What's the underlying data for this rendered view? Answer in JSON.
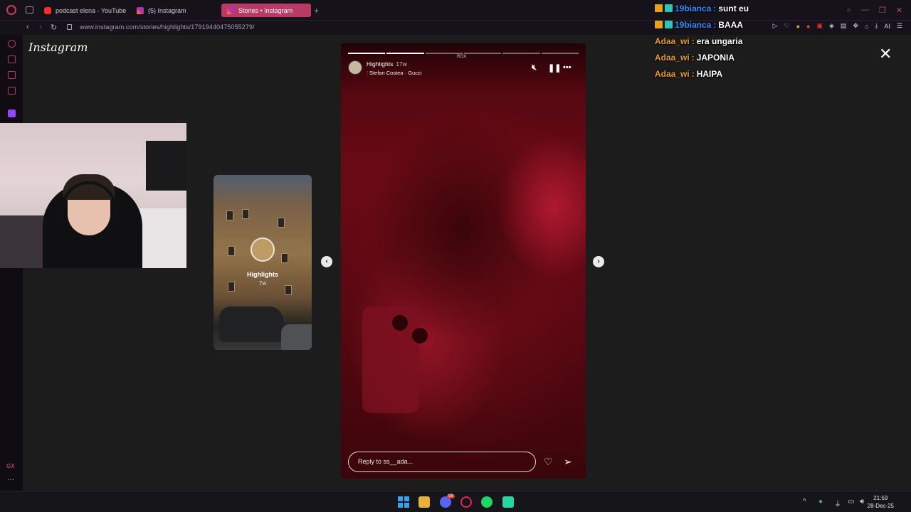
{
  "browser": {
    "tabs": [
      {
        "label": "podcast elena - YouTube",
        "icon": "youtube-icon"
      },
      {
        "label": "(5) Instagram",
        "icon": "instagram-icon"
      },
      {
        "label": "Stories • Instagram",
        "icon": "instagram-icon",
        "active": true
      }
    ],
    "url": "www.instagram.com/stories/highlights/17919440475055279/"
  },
  "instagram": {
    "logo": "Instagram",
    "side_story": {
      "title": "Highlights",
      "time": "7w"
    },
    "story": {
      "watermark": "RGX",
      "username": "Highlights",
      "time": "17w",
      "music": "Stefan Costea · Gucci",
      "progress": [
        1.0,
        1.0,
        0.0,
        0.0,
        0.0,
        0.0
      ],
      "reply_placeholder": "Reply to ss__ada..."
    }
  },
  "chat": [
    {
      "user": "19bianca",
      "message": "sunt eu",
      "color": "#2e8fff",
      "badges": [
        "crown-badge",
        "sub-badge"
      ]
    },
    {
      "user": "19bianca",
      "message": "BAAA",
      "color": "#2e8fff",
      "badges": [
        "crown-badge",
        "sub-badge"
      ]
    },
    {
      "user": "Adaa_wi",
      "message": "era ungaria",
      "color": "#e89c27",
      "badges": []
    },
    {
      "user": "Adaa_wi",
      "message": "JAPONIA",
      "color": "#e89c27",
      "badges": []
    },
    {
      "user": "Adaa_wi",
      "message": "HAIPA",
      "color": "#e89c27",
      "badges": []
    }
  ],
  "taskbar": {
    "time": "21:59",
    "date": "28-Dec-25",
    "discord_badge": "99"
  },
  "extension_label": "AI",
  "sidebar_gx": "GX"
}
